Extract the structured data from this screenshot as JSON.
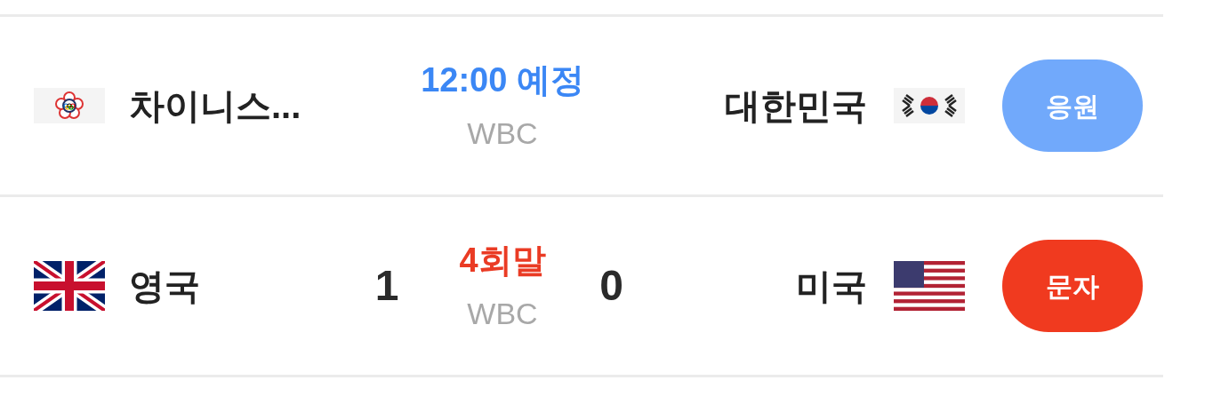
{
  "matches": [
    {
      "home": {
        "name": "차이니스...",
        "flag": {
          "kind": "tpe"
        }
      },
      "away": {
        "name": "대한민국",
        "flag": {
          "kind": "kor"
        }
      },
      "status": {
        "text": "12:00 예정",
        "kind": "scheduled"
      },
      "league": "WBC",
      "button": {
        "label": "응원",
        "kind": "cheer"
      }
    },
    {
      "home": {
        "name": "영국",
        "flag": {
          "kind": "gbr"
        },
        "score": "1"
      },
      "away": {
        "name": "미국",
        "flag": {
          "kind": "usa"
        },
        "score": "0"
      },
      "status": {
        "text": "4회말",
        "kind": "live"
      },
      "league": "WBC",
      "button": {
        "label": "문자",
        "kind": "message"
      }
    }
  ]
}
